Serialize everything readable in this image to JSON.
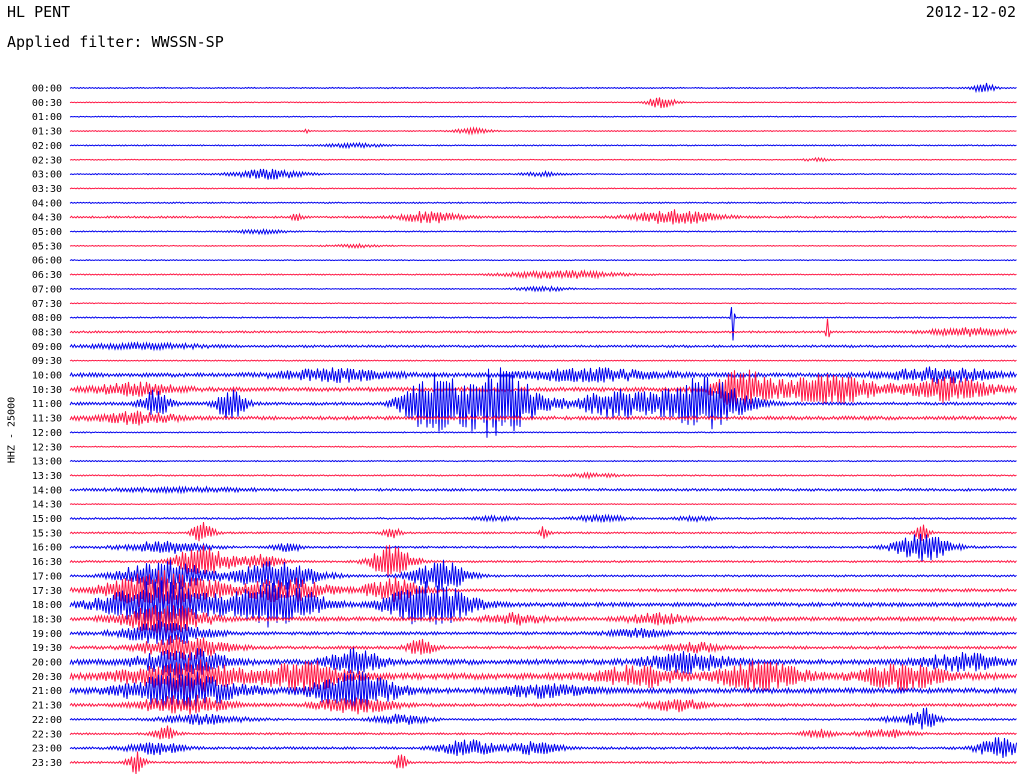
{
  "header": {
    "station": "HL PENT",
    "filter_label": "Applied filter: WWSSN-SP",
    "date": "2012-12-02"
  },
  "channel_label": "HHZ - 25000",
  "colors": {
    "even": "#0000ee",
    "odd": "#ff1744"
  },
  "chart_data": {
    "type": "line",
    "title": "",
    "xlabel": "",
    "ylabel": "HHZ - 25000",
    "rows": [
      {
        "label": "00:00",
        "noise": 0.6,
        "events": [
          {
            "t": 0.965,
            "a": 5,
            "w": 0.008
          }
        ]
      },
      {
        "label": "00:30",
        "noise": 0.5,
        "events": [
          {
            "t": 0.625,
            "a": 6,
            "w": 0.01
          }
        ]
      },
      {
        "label": "01:00",
        "noise": 0.5,
        "events": []
      },
      {
        "label": "01:30",
        "noise": 0.5,
        "events": [
          {
            "t": 0.425,
            "a": 3,
            "w": 0.012
          },
          {
            "t": 0.25,
            "a": 2,
            "w": 0.002
          }
        ]
      },
      {
        "label": "02:00",
        "noise": 0.6,
        "events": [
          {
            "t": 0.3,
            "a": 2,
            "w": 0.02
          }
        ]
      },
      {
        "label": "02:30",
        "noise": 0.5,
        "events": [
          {
            "t": 0.79,
            "a": 1.5,
            "w": 0.01
          }
        ]
      },
      {
        "label": "03:00",
        "noise": 0.6,
        "events": [
          {
            "t": 0.21,
            "a": 5,
            "w": 0.025
          },
          {
            "t": 0.5,
            "a": 2,
            "w": 0.015
          }
        ]
      },
      {
        "label": "03:30",
        "noise": 0.5,
        "events": []
      },
      {
        "label": "04:00",
        "noise": 0.7,
        "events": []
      },
      {
        "label": "04:30",
        "noise": 1.0,
        "events": [
          {
            "t": 0.38,
            "a": 6,
            "w": 0.02
          },
          {
            "t": 0.64,
            "a": 7,
            "w": 0.03
          },
          {
            "t": 0.24,
            "a": 3,
            "w": 0.005
          }
        ]
      },
      {
        "label": "05:00",
        "noise": 0.6,
        "events": [
          {
            "t": 0.2,
            "a": 2,
            "w": 0.02
          }
        ]
      },
      {
        "label": "05:30",
        "noise": 0.5,
        "events": [
          {
            "t": 0.3,
            "a": 1.5,
            "w": 0.02
          }
        ]
      },
      {
        "label": "06:00",
        "noise": 0.5,
        "events": []
      },
      {
        "label": "06:30",
        "noise": 0.6,
        "events": [
          {
            "t": 0.52,
            "a": 4,
            "w": 0.04
          }
        ]
      },
      {
        "label": "07:00",
        "noise": 0.5,
        "events": [
          {
            "t": 0.5,
            "a": 2,
            "w": 0.02
          }
        ]
      },
      {
        "label": "07:30",
        "noise": 0.5,
        "events": []
      },
      {
        "label": "08:00",
        "noise": 0.7,
        "events": [
          {
            "t": 0.7,
            "a": 32,
            "w": 0.001
          }
        ]
      },
      {
        "label": "08:30",
        "noise": 1.0,
        "events": [
          {
            "t": 0.8,
            "a": 18,
            "w": 0.001
          },
          {
            "t": 0.95,
            "a": 4,
            "w": 0.03
          }
        ]
      },
      {
        "label": "09:00",
        "noise": 1.2,
        "events": [
          {
            "t": 0.08,
            "a": 3,
            "w": 0.04
          }
        ]
      },
      {
        "label": "09:30",
        "noise": 0.6,
        "events": []
      },
      {
        "label": "10:00",
        "noise": 2.0,
        "events": [
          {
            "t": 0.28,
            "a": 6,
            "w": 0.04
          },
          {
            "t": 0.55,
            "a": 6,
            "w": 0.05
          },
          {
            "t": 0.92,
            "a": 7,
            "w": 0.04
          }
        ]
      },
      {
        "label": "10:30",
        "noise": 2.0,
        "events": [
          {
            "t": 0.07,
            "a": 6,
            "w": 0.03
          },
          {
            "t": 0.71,
            "a": 18,
            "w": 0.02
          },
          {
            "t": 0.8,
            "a": 14,
            "w": 0.04
          },
          {
            "t": 0.93,
            "a": 12,
            "w": 0.03
          }
        ]
      },
      {
        "label": "11:00",
        "noise": 1.5,
        "events": [
          {
            "t": 0.09,
            "a": 14,
            "w": 0.01
          },
          {
            "t": 0.17,
            "a": 18,
            "w": 0.01
          },
          {
            "t": 0.38,
            "a": 26,
            "w": 0.02
          },
          {
            "t": 0.45,
            "a": 36,
            "w": 0.03
          },
          {
            "t": 0.58,
            "a": 14,
            "w": 0.03
          },
          {
            "t": 0.67,
            "a": 26,
            "w": 0.03
          }
        ]
      },
      {
        "label": "11:30",
        "noise": 1.8,
        "events": [
          {
            "t": 0.07,
            "a": 6,
            "w": 0.03
          }
        ]
      },
      {
        "label": "12:00",
        "noise": 0.6,
        "events": []
      },
      {
        "label": "12:30",
        "noise": 0.6,
        "events": []
      },
      {
        "label": "13:00",
        "noise": 0.6,
        "events": []
      },
      {
        "label": "13:30",
        "noise": 0.7,
        "events": [
          {
            "t": 0.55,
            "a": 2,
            "w": 0.02
          }
        ]
      },
      {
        "label": "14:00",
        "noise": 1.2,
        "events": [
          {
            "t": 0.12,
            "a": 2,
            "w": 0.05
          }
        ]
      },
      {
        "label": "14:30",
        "noise": 0.5,
        "events": []
      },
      {
        "label": "15:00",
        "noise": 0.9,
        "events": [
          {
            "t": 0.56,
            "a": 3,
            "w": 0.02
          },
          {
            "t": 0.45,
            "a": 2,
            "w": 0.015
          },
          {
            "t": 0.66,
            "a": 2,
            "w": 0.015
          }
        ]
      },
      {
        "label": "15:30",
        "noise": 0.9,
        "events": [
          {
            "t": 0.14,
            "a": 10,
            "w": 0.008
          },
          {
            "t": 0.34,
            "a": 6,
            "w": 0.006
          },
          {
            "t": 0.5,
            "a": 6,
            "w": 0.004
          },
          {
            "t": 0.9,
            "a": 8,
            "w": 0.006
          }
        ]
      },
      {
        "label": "16:00",
        "noise": 1.0,
        "events": [
          {
            "t": 0.1,
            "a": 6,
            "w": 0.03
          },
          {
            "t": 0.23,
            "a": 5,
            "w": 0.01
          },
          {
            "t": 0.9,
            "a": 14,
            "w": 0.02
          }
        ]
      },
      {
        "label": "16:30",
        "noise": 1.0,
        "events": [
          {
            "t": 0.14,
            "a": 16,
            "w": 0.02
          },
          {
            "t": 0.34,
            "a": 18,
            "w": 0.015
          },
          {
            "t": 0.2,
            "a": 7,
            "w": 0.015
          }
        ]
      },
      {
        "label": "17:00",
        "noise": 1.0,
        "events": [
          {
            "t": 0.1,
            "a": 18,
            "w": 0.03
          },
          {
            "t": 0.22,
            "a": 16,
            "w": 0.03
          },
          {
            "t": 0.39,
            "a": 16,
            "w": 0.02
          }
        ]
      },
      {
        "label": "17:30",
        "noise": 1.5,
        "events": [
          {
            "t": 0.1,
            "a": 20,
            "w": 0.04
          },
          {
            "t": 0.23,
            "a": 12,
            "w": 0.03
          },
          {
            "t": 0.34,
            "a": 12,
            "w": 0.02
          }
        ]
      },
      {
        "label": "18:00",
        "noise": 2.0,
        "events": [
          {
            "t": 0.1,
            "a": 24,
            "w": 0.04
          },
          {
            "t": 0.22,
            "a": 22,
            "w": 0.03
          },
          {
            "t": 0.38,
            "a": 22,
            "w": 0.03
          }
        ]
      },
      {
        "label": "18:30",
        "noise": 2.0,
        "events": [
          {
            "t": 0.1,
            "a": 14,
            "w": 0.03
          },
          {
            "t": 0.47,
            "a": 5,
            "w": 0.02
          },
          {
            "t": 0.62,
            "a": 5,
            "w": 0.02
          }
        ]
      },
      {
        "label": "19:00",
        "noise": 1.5,
        "events": [
          {
            "t": 0.1,
            "a": 12,
            "w": 0.03
          },
          {
            "t": 0.6,
            "a": 4,
            "w": 0.02
          }
        ]
      },
      {
        "label": "19:30",
        "noise": 1.5,
        "events": [
          {
            "t": 0.12,
            "a": 12,
            "w": 0.03
          },
          {
            "t": 0.37,
            "a": 8,
            "w": 0.01
          },
          {
            "t": 0.66,
            "a": 5,
            "w": 0.02
          }
        ]
      },
      {
        "label": "20:00",
        "noise": 2.5,
        "events": [
          {
            "t": 0.12,
            "a": 14,
            "w": 0.03
          },
          {
            "t": 0.3,
            "a": 12,
            "w": 0.02
          },
          {
            "t": 0.65,
            "a": 10,
            "w": 0.03
          },
          {
            "t": 0.94,
            "a": 8,
            "w": 0.03
          }
        ]
      },
      {
        "label": "20:30",
        "noise": 3.0,
        "events": [
          {
            "t": 0.12,
            "a": 16,
            "w": 0.04
          },
          {
            "t": 0.25,
            "a": 14,
            "w": 0.03
          },
          {
            "t": 0.6,
            "a": 10,
            "w": 0.03
          },
          {
            "t": 0.73,
            "a": 14,
            "w": 0.03
          },
          {
            "t": 0.88,
            "a": 12,
            "w": 0.03
          }
        ]
      },
      {
        "label": "21:00",
        "noise": 2.5,
        "events": [
          {
            "t": 0.12,
            "a": 18,
            "w": 0.04
          },
          {
            "t": 0.3,
            "a": 18,
            "w": 0.03
          },
          {
            "t": 0.5,
            "a": 6,
            "w": 0.03
          }
        ]
      },
      {
        "label": "21:30",
        "noise": 1.5,
        "events": [
          {
            "t": 0.12,
            "a": 10,
            "w": 0.03
          },
          {
            "t": 0.3,
            "a": 8,
            "w": 0.03
          },
          {
            "t": 0.64,
            "a": 6,
            "w": 0.02
          }
        ]
      },
      {
        "label": "22:00",
        "noise": 1.0,
        "events": [
          {
            "t": 0.14,
            "a": 5,
            "w": 0.03
          },
          {
            "t": 0.35,
            "a": 5,
            "w": 0.02
          },
          {
            "t": 0.89,
            "a": 5,
            "w": 0.02
          },
          {
            "t": 0.905,
            "a": 8,
            "w": 0.006
          }
        ]
      },
      {
        "label": "22:30",
        "noise": 1.0,
        "events": [
          {
            "t": 0.1,
            "a": 8,
            "w": 0.008
          },
          {
            "t": 0.79,
            "a": 5,
            "w": 0.01
          },
          {
            "t": 0.86,
            "a": 4,
            "w": 0.02
          }
        ]
      },
      {
        "label": "23:00",
        "noise": 1.2,
        "events": [
          {
            "t": 0.09,
            "a": 6,
            "w": 0.02
          },
          {
            "t": 0.42,
            "a": 8,
            "w": 0.02
          },
          {
            "t": 0.49,
            "a": 6,
            "w": 0.02
          },
          {
            "t": 0.98,
            "a": 10,
            "w": 0.015
          }
        ]
      },
      {
        "label": "23:30",
        "noise": 1.0,
        "events": [
          {
            "t": 0.07,
            "a": 12,
            "w": 0.006
          },
          {
            "t": 0.35,
            "a": 10,
            "w": 0.004
          }
        ]
      }
    ]
  }
}
